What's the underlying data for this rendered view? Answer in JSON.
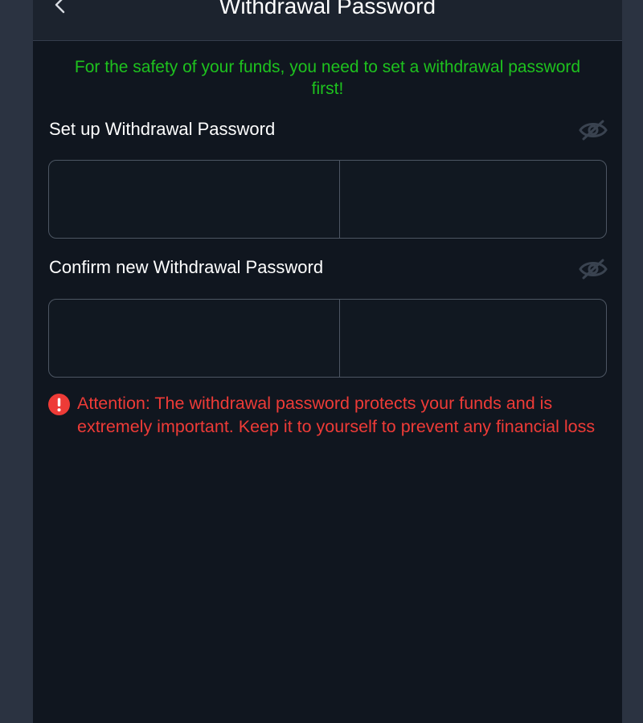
{
  "header": {
    "title": "Withdrawal Password",
    "back_icon": "chevron-left-icon"
  },
  "notice": {
    "text": "For the safety of your funds, you need to set a withdrawal password first!",
    "color": "#1ec21e"
  },
  "fields": [
    {
      "label": "Set up Withdrawal Password",
      "toggle_icon": "eye-off-icon",
      "digits": 6
    },
    {
      "label": "Confirm new Withdrawal Password",
      "toggle_icon": "eye-off-icon",
      "digits": 6
    }
  ],
  "attention": {
    "icon": "exclamation-circle-icon",
    "text": "Attention: The withdrawal password protects your funds and is extremely important. Keep it to yourself to prevent any financial loss",
    "color": "#ee3b37"
  },
  "colors": {
    "background": "#10161f",
    "header_background": "#1c232e",
    "outer_background": "#2b3341",
    "border": "#4d5663"
  }
}
